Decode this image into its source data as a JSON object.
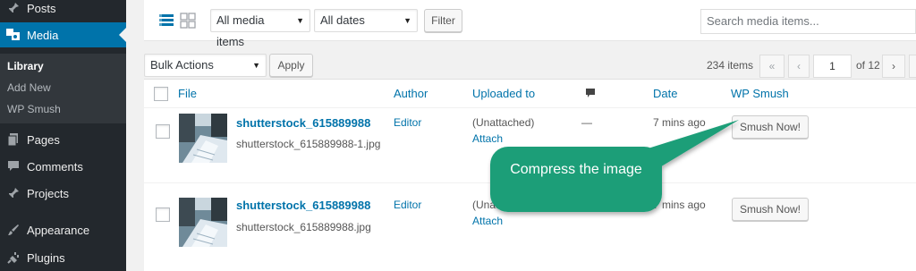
{
  "colors": {
    "sidebar_bg": "#23282d",
    "accent": "#0073aa",
    "callout": "#1a9e78"
  },
  "sidebar": {
    "items": [
      {
        "label": "Posts",
        "icon": "pin-icon"
      },
      {
        "label": "Media",
        "icon": "media-icon"
      },
      {
        "label": "Pages",
        "icon": "pages-icon"
      },
      {
        "label": "Comments",
        "icon": "comment-icon"
      },
      {
        "label": "Projects",
        "icon": "pin-icon"
      },
      {
        "label": "Appearance",
        "icon": "brush-icon"
      },
      {
        "label": "Plugins",
        "icon": "plug-icon"
      }
    ],
    "submenu": [
      "Library",
      "Add New",
      "WP Smush"
    ]
  },
  "filters": {
    "type_select": "All media items",
    "date_select": "All dates",
    "filter_button": "Filter",
    "search_placeholder": "Search media items..."
  },
  "bulk": {
    "select": "Bulk Actions",
    "apply_button": "Apply"
  },
  "pagination": {
    "count": "234 items",
    "first": "«",
    "prev": "‹",
    "current_page": "1",
    "of_pages": "of 12",
    "next": "›"
  },
  "table": {
    "headers": {
      "file": "File",
      "author": "Author",
      "uploaded_to": "Uploaded to",
      "date": "Date",
      "smush": "WP Smush"
    },
    "rows": [
      {
        "title": "shutterstock_615889988",
        "filename": "shutterstock_615889988-1.jpg",
        "author": "Editor",
        "uploaded": "(Unattached)",
        "attach": "Attach",
        "comments": "—",
        "date": "7 mins ago",
        "action": "Smush Now!"
      },
      {
        "title": "shutterstock_615889988",
        "filename": "shutterstock_615889988.jpg",
        "author": "Editor",
        "uploaded": "(Unattached)",
        "attach": "Attach",
        "comments": "—",
        "date": "7 mins ago",
        "action": "Smush Now!"
      }
    ]
  },
  "callout": {
    "text": "Compress the image"
  }
}
